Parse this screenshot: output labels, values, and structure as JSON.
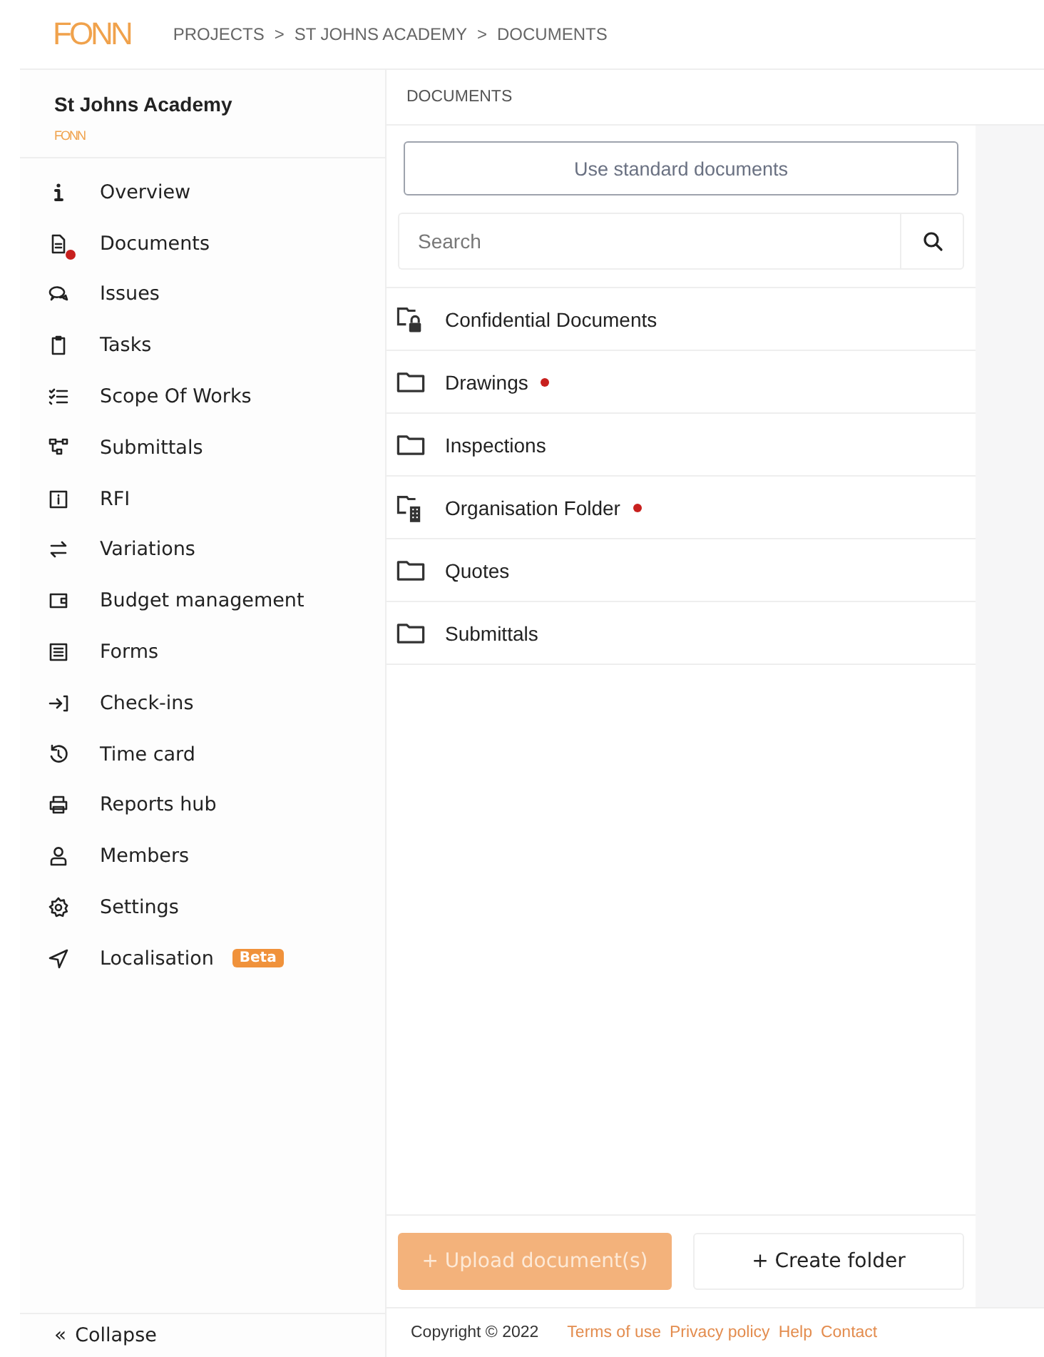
{
  "header": {
    "logo": "FONN",
    "breadcrumb": [
      "PROJECTS",
      "ST JOHNS ACADEMY",
      "DOCUMENTS"
    ],
    "separator": ">"
  },
  "sidebar": {
    "project_title": "St Johns Academy",
    "company_logo": "FONN",
    "items": [
      {
        "label": "Overview",
        "notification": false
      },
      {
        "label": "Documents",
        "notification": true
      },
      {
        "label": "Issues",
        "notification": false
      },
      {
        "label": "Tasks",
        "notification": false
      },
      {
        "label": "Scope Of Works",
        "notification": false
      },
      {
        "label": "Submittals",
        "notification": false
      },
      {
        "label": "RFI",
        "notification": false
      },
      {
        "label": "Variations",
        "notification": false
      },
      {
        "label": "Budget management",
        "notification": false
      },
      {
        "label": "Forms",
        "notification": false
      },
      {
        "label": "Check-ins",
        "notification": false
      },
      {
        "label": "Time card",
        "notification": false
      },
      {
        "label": "Reports hub",
        "notification": false
      },
      {
        "label": "Members",
        "notification": false
      },
      {
        "label": "Settings",
        "notification": false
      },
      {
        "label": "Localisation",
        "notification": false,
        "badge": "Beta"
      }
    ],
    "collapse": {
      "icon_text": "«",
      "label": "Collapse"
    }
  },
  "main": {
    "section_title": "DOCUMENTS",
    "standard_button": "Use standard documents",
    "search": {
      "placeholder": "Search"
    },
    "folders": [
      {
        "name": "Confidential Documents",
        "kind": "locked",
        "unread": false
      },
      {
        "name": "Drawings",
        "kind": "plain",
        "unread": true
      },
      {
        "name": "Inspections",
        "kind": "plain",
        "unread": false
      },
      {
        "name": "Organisation Folder",
        "kind": "organisation",
        "unread": true
      },
      {
        "name": "Quotes",
        "kind": "plain",
        "unread": false
      },
      {
        "name": "Submittals",
        "kind": "plain",
        "unread": false
      }
    ],
    "upload_button": {
      "label": "+ Upload document(s)",
      "disabled": true
    },
    "create_button": {
      "label": "+ Create folder",
      "disabled": false
    }
  },
  "footer": {
    "copyright": "Copyright © 2022",
    "links": [
      "Terms of use",
      "Privacy policy",
      "Help",
      "Contact"
    ]
  }
}
